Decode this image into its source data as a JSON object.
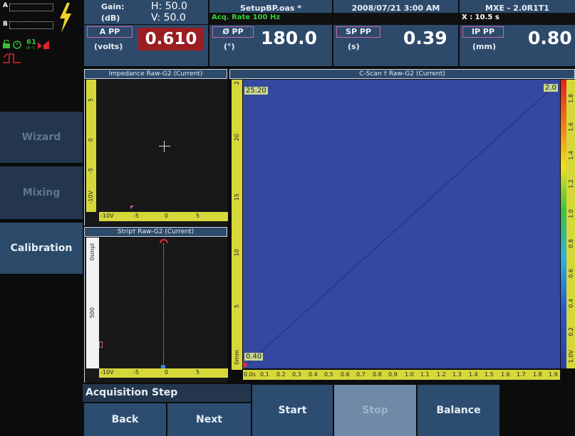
{
  "status": {
    "channel_a": "A",
    "channel_b": "B",
    "battery_level": "61",
    "battery_unit": "IN °C"
  },
  "header": {
    "gain_label": "Gain:",
    "gain_unit": "(dB)",
    "gain_h": "H: 50.0",
    "gain_v": "V: 50.0",
    "file_name": "SetupBP.oas *",
    "acq_rate": "Acq. Rate 100  Hz",
    "datetime": "2008/07/21 3:00 AM",
    "firmware": "MXE - 2.0R1T1",
    "x_readout": "X : 10.5 s"
  },
  "readouts": [
    {
      "label": "A PP",
      "unit": "(volts)",
      "value": "0.610"
    },
    {
      "label": "Ø PP",
      "unit": "(°)",
      "value": "180.0"
    },
    {
      "label": "SP PP",
      "unit": "(s)",
      "value": "0.39"
    },
    {
      "label": "IP PP",
      "unit": "(mm)",
      "value": "0.80"
    }
  ],
  "panels": {
    "impedance_title": "Impedance Raw-G2 (Current)",
    "strip_title": "Strip† Raw-G2 (Current)",
    "cscan_title": "C-Scan † Raw-G2 (Current)"
  },
  "impedance": {
    "y_ticks": [
      "5",
      "0",
      "-5",
      "-10V"
    ],
    "x_ticks": [
      "-10V",
      "-5",
      "0",
      "5"
    ]
  },
  "strip": {
    "y_ticks": [
      "0smpl",
      "500"
    ],
    "x_ticks": [
      "-10V",
      "-5",
      "0",
      "5"
    ]
  },
  "cscan": {
    "y_ticks": [
      "2",
      "20",
      "15",
      "10",
      "5",
      "0mm"
    ],
    "x_ticks": [
      "0.0s",
      "0.1",
      "0.2",
      "0.3",
      "0.4",
      "0.5",
      "0.6",
      "0.7",
      "0.8",
      "0.9",
      "1.0",
      "1.1",
      "1.2",
      "1.3",
      "1.4",
      "1.5",
      "1.6",
      "1.7",
      "1.8",
      "1.9"
    ],
    "top_value": "25.20",
    "bottom_value": "0.40",
    "scale_max": "2.0",
    "color_bar_ticks": [
      "1.8",
      "1.6",
      "1.4",
      "1.2",
      "1.0",
      "0.8",
      "0.6",
      "0.4",
      "0.2",
      "1.0V"
    ]
  },
  "sidebar": {
    "items": [
      "Wizard",
      "Mixing",
      "Calibration"
    ]
  },
  "bottom": {
    "step_label": "Acquisition Step",
    "buttons": [
      "Back",
      "Next",
      "Start",
      "Stop",
      "Balance"
    ]
  },
  "colors": {
    "header_bg": "#2e4a6b",
    "cscan_bg": "#33489e",
    "value_red": "#9b1d22",
    "ruler": "#d6d83a"
  }
}
